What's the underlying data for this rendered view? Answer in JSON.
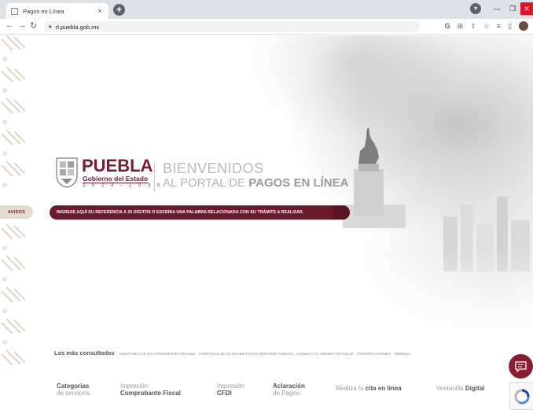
{
  "browser": {
    "tab_title": "Pagos en Línea",
    "tab_close": "×",
    "new_tab": "+",
    "url": "rl.puebla.gob.mx"
  },
  "logo": {
    "name": "PUEBLA",
    "subtitle": "Gobierno del Estado",
    "years": "2 0 2 4 - 2 0 3 0"
  },
  "hero": {
    "welcome": "BIENVENIDOS",
    "portal_prefix": "AL PORTAL DE ",
    "portal_bold": "PAGOS EN LÍNEA"
  },
  "search": {
    "placeholder": "INGRESE AQUÍ SU REFERENCIA A 20 DÍGITOS O ESCRIBA UNA PALABRA RELACIONADA CON SU TRÁMITE A REALIZAR."
  },
  "side_tab": {
    "label": "AVISOS"
  },
  "consulted": {
    "label": "Los más consultados",
    "items": [
      "CONSTANCIA DE NO ANTECEDENTES PENALES",
      "CONSTANCIA DE NO INHABILITACIÓN (SERVIDOR PÚBLICO)",
      "CONSULTA TU ADEUDO VEHICULAR",
      "FOTOINFRACCIONES",
      "TENENCIA"
    ]
  },
  "footer_nav": {
    "categorias": {
      "top": "Categorías",
      "bottom": "de servicios"
    },
    "impresion_fiscal": {
      "top": "Impresión",
      "bottom": "Comprobante Fiscal"
    },
    "impresion_cfdi": {
      "top": "Impresión",
      "bottom": "CFDI"
    },
    "aclaracion": {
      "top": "Aclaración",
      "bottom": "de Pagos"
    },
    "cita": {
      "prefix": "Realiza tu ",
      "bold": "cita en línea"
    },
    "ventanilla": {
      "prefix": "Ventanilla ",
      "bold": "Digital"
    }
  },
  "colors": {
    "brand": "#6b1a2b",
    "brand_text": "#7a1c2e",
    "chat": "#8a1e31"
  }
}
